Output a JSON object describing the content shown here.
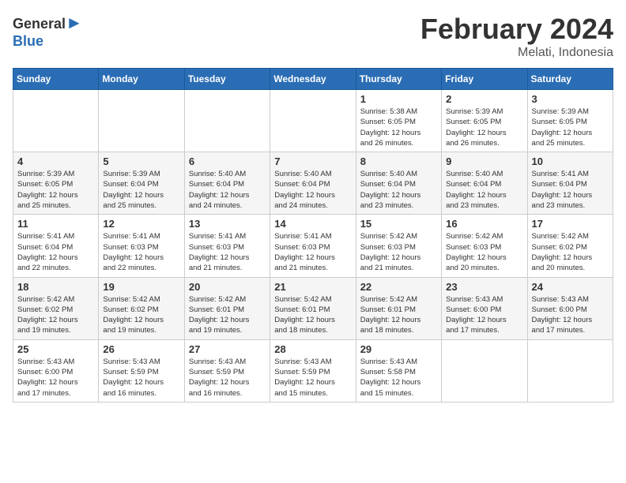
{
  "header": {
    "logo_general": "General",
    "logo_blue": "Blue",
    "month": "February 2024",
    "location": "Melati, Indonesia"
  },
  "weekdays": [
    "Sunday",
    "Monday",
    "Tuesday",
    "Wednesday",
    "Thursday",
    "Friday",
    "Saturday"
  ],
  "weeks": [
    [
      {
        "day": "",
        "info": ""
      },
      {
        "day": "",
        "info": ""
      },
      {
        "day": "",
        "info": ""
      },
      {
        "day": "",
        "info": ""
      },
      {
        "day": "1",
        "info": "Sunrise: 5:38 AM\nSunset: 6:05 PM\nDaylight: 12 hours\nand 26 minutes."
      },
      {
        "day": "2",
        "info": "Sunrise: 5:39 AM\nSunset: 6:05 PM\nDaylight: 12 hours\nand 26 minutes."
      },
      {
        "day": "3",
        "info": "Sunrise: 5:39 AM\nSunset: 6:05 PM\nDaylight: 12 hours\nand 25 minutes."
      }
    ],
    [
      {
        "day": "4",
        "info": "Sunrise: 5:39 AM\nSunset: 6:05 PM\nDaylight: 12 hours\nand 25 minutes."
      },
      {
        "day": "5",
        "info": "Sunrise: 5:39 AM\nSunset: 6:04 PM\nDaylight: 12 hours\nand 25 minutes."
      },
      {
        "day": "6",
        "info": "Sunrise: 5:40 AM\nSunset: 6:04 PM\nDaylight: 12 hours\nand 24 minutes."
      },
      {
        "day": "7",
        "info": "Sunrise: 5:40 AM\nSunset: 6:04 PM\nDaylight: 12 hours\nand 24 minutes."
      },
      {
        "day": "8",
        "info": "Sunrise: 5:40 AM\nSunset: 6:04 PM\nDaylight: 12 hours\nand 23 minutes."
      },
      {
        "day": "9",
        "info": "Sunrise: 5:40 AM\nSunset: 6:04 PM\nDaylight: 12 hours\nand 23 minutes."
      },
      {
        "day": "10",
        "info": "Sunrise: 5:41 AM\nSunset: 6:04 PM\nDaylight: 12 hours\nand 23 minutes."
      }
    ],
    [
      {
        "day": "11",
        "info": "Sunrise: 5:41 AM\nSunset: 6:04 PM\nDaylight: 12 hours\nand 22 minutes."
      },
      {
        "day": "12",
        "info": "Sunrise: 5:41 AM\nSunset: 6:03 PM\nDaylight: 12 hours\nand 22 minutes."
      },
      {
        "day": "13",
        "info": "Sunrise: 5:41 AM\nSunset: 6:03 PM\nDaylight: 12 hours\nand 21 minutes."
      },
      {
        "day": "14",
        "info": "Sunrise: 5:41 AM\nSunset: 6:03 PM\nDaylight: 12 hours\nand 21 minutes."
      },
      {
        "day": "15",
        "info": "Sunrise: 5:42 AM\nSunset: 6:03 PM\nDaylight: 12 hours\nand 21 minutes."
      },
      {
        "day": "16",
        "info": "Sunrise: 5:42 AM\nSunset: 6:03 PM\nDaylight: 12 hours\nand 20 minutes."
      },
      {
        "day": "17",
        "info": "Sunrise: 5:42 AM\nSunset: 6:02 PM\nDaylight: 12 hours\nand 20 minutes."
      }
    ],
    [
      {
        "day": "18",
        "info": "Sunrise: 5:42 AM\nSunset: 6:02 PM\nDaylight: 12 hours\nand 19 minutes."
      },
      {
        "day": "19",
        "info": "Sunrise: 5:42 AM\nSunset: 6:02 PM\nDaylight: 12 hours\nand 19 minutes."
      },
      {
        "day": "20",
        "info": "Sunrise: 5:42 AM\nSunset: 6:01 PM\nDaylight: 12 hours\nand 19 minutes."
      },
      {
        "day": "21",
        "info": "Sunrise: 5:42 AM\nSunset: 6:01 PM\nDaylight: 12 hours\nand 18 minutes."
      },
      {
        "day": "22",
        "info": "Sunrise: 5:42 AM\nSunset: 6:01 PM\nDaylight: 12 hours\nand 18 minutes."
      },
      {
        "day": "23",
        "info": "Sunrise: 5:43 AM\nSunset: 6:00 PM\nDaylight: 12 hours\nand 17 minutes."
      },
      {
        "day": "24",
        "info": "Sunrise: 5:43 AM\nSunset: 6:00 PM\nDaylight: 12 hours\nand 17 minutes."
      }
    ],
    [
      {
        "day": "25",
        "info": "Sunrise: 5:43 AM\nSunset: 6:00 PM\nDaylight: 12 hours\nand 17 minutes."
      },
      {
        "day": "26",
        "info": "Sunrise: 5:43 AM\nSunset: 5:59 PM\nDaylight: 12 hours\nand 16 minutes."
      },
      {
        "day": "27",
        "info": "Sunrise: 5:43 AM\nSunset: 5:59 PM\nDaylight: 12 hours\nand 16 minutes."
      },
      {
        "day": "28",
        "info": "Sunrise: 5:43 AM\nSunset: 5:59 PM\nDaylight: 12 hours\nand 15 minutes."
      },
      {
        "day": "29",
        "info": "Sunrise: 5:43 AM\nSunset: 5:58 PM\nDaylight: 12 hours\nand 15 minutes."
      },
      {
        "day": "",
        "info": ""
      },
      {
        "day": "",
        "info": ""
      }
    ]
  ]
}
